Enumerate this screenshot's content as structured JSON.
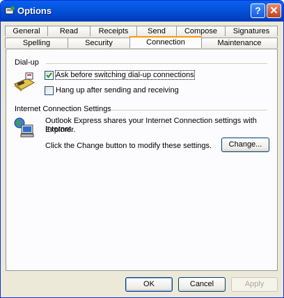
{
  "window": {
    "title": "Options"
  },
  "tabs": {
    "row1": [
      "General",
      "Read",
      "Receipts",
      "Send",
      "Compose",
      "Signatures"
    ],
    "row2": [
      "Spelling",
      "Security",
      "Connection",
      "Maintenance"
    ],
    "active": "Connection"
  },
  "dialup": {
    "group_label": "Dial-up",
    "options": [
      {
        "label": "Ask before switching dial-up connections",
        "checked": true
      },
      {
        "label": "Hang up after sending and receiving",
        "checked": false
      }
    ]
  },
  "internet": {
    "group_label": "Internet Connection Settings",
    "description_line1": "Outlook Express shares your Internet Connection settings with Internet",
    "description_line2": "Explorer.",
    "change_hint": "Click the Change button to modify these settings.",
    "change_button": "Change..."
  },
  "footer": {
    "ok": "OK",
    "cancel": "Cancel",
    "apply": "Apply"
  }
}
